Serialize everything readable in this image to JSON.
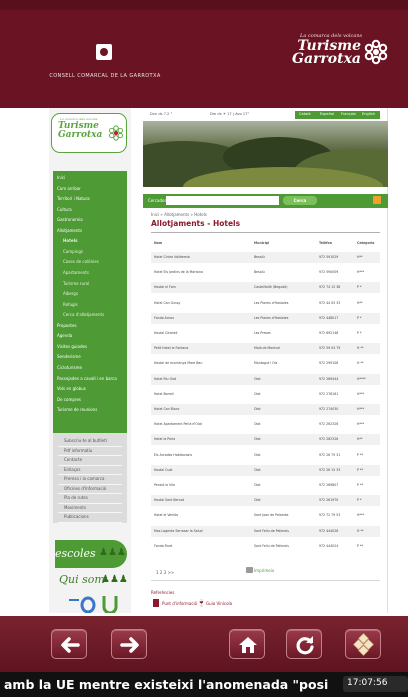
{
  "header": {
    "council_name": "CONSELL COMARCAL DE LA GARROTXA",
    "brand_tagline": "La comarca dels volcans",
    "brand_name": "Turisme Garrotxa"
  },
  "topbar": {
    "date": "Dvn ds 7.2 °",
    "weather": "Dm ds ☀ 17 | Avo 17°",
    "languages": [
      "Català",
      "Español",
      "Français",
      "English"
    ]
  },
  "sidebar": {
    "logo_tagline": "La comarca dels volcans",
    "logo_name": "Turisme Garrotxa",
    "nav": [
      {
        "label": "Inici",
        "sub": false
      },
      {
        "label": "Com arribar",
        "sub": false
      },
      {
        "label": "Territori i Natura",
        "sub": false
      },
      {
        "label": "Cultura",
        "sub": false
      },
      {
        "label": "Gastronomia",
        "sub": false
      },
      {
        "label": "Allotjaments",
        "sub": false
      },
      {
        "label": "Hotels",
        "sub": true,
        "active": true
      },
      {
        "label": "Campings",
        "sub": true
      },
      {
        "label": "Cases de colònies",
        "sub": true
      },
      {
        "label": "Apartaments",
        "sub": true
      },
      {
        "label": "Turisme rural",
        "sub": true
      },
      {
        "label": "Albergs",
        "sub": true
      },
      {
        "label": "Refugis",
        "sub": true
      },
      {
        "label": "Cerca d'allotjaments",
        "sub": true
      },
      {
        "label": "Propostes",
        "sub": false
      },
      {
        "label": "Agenda",
        "sub": false
      },
      {
        "label": "Visites guiades",
        "sub": false
      },
      {
        "label": "Senderisme",
        "sub": false
      },
      {
        "label": "Cicloturisme",
        "sub": false
      },
      {
        "label": "Passejades a cavall i en barca",
        "sub": false
      },
      {
        "label": "Vols en globus",
        "sub": false
      },
      {
        "label": "De compres",
        "sub": false
      },
      {
        "label": "Turisme de reunions",
        "sub": false
      }
    ],
    "secondary": [
      "Subscriu-te al butlletí",
      "Pdf informatiu",
      "Contacte",
      "Enllaços",
      "Premsa i la comarca",
      "Oficines d'Informació",
      "Pla de rutes",
      "Moviments",
      "Publicacions"
    ],
    "promo_escoles": "escoles",
    "promo_quisom": "Qui som"
  },
  "search": {
    "label": "Cercador",
    "placeholder": "",
    "button": "Cerca"
  },
  "content": {
    "breadcrumb": "Inici » Allotjaments » Hotels",
    "title": "Allotjaments - Hotels",
    "columns": [
      "Nom",
      "",
      "Municipi",
      "Telèfon",
      "Categoria"
    ],
    "rows": [
      {
        "name": "Hotel Cintra Valldemia",
        "icon": true,
        "town": "Besalú",
        "phone": "972 591029",
        "cat": "H**"
      },
      {
        "name": "Hotel Els Jardins de la Martana",
        "icon": false,
        "town": "Besalú",
        "phone": "972 590009",
        "cat": "H***"
      },
      {
        "name": "Hostal el Forn",
        "icon": false,
        "town": "Castellfollit (Begudà)",
        "phone": "972 74 12 38",
        "cat": "P *"
      },
      {
        "name": "Hotel Can Gussy",
        "icon": false,
        "town": "Les Planes d'Hostoles",
        "phone": "972 44 05 33",
        "cat": "H**"
      },
      {
        "name": "Fonda Arnau",
        "icon": false,
        "town": "Les Planes d'Hostoles",
        "phone": "972 448017",
        "cat": "P *"
      },
      {
        "name": "Hostal Gironell",
        "icon": false,
        "town": "Les Preses",
        "phone": "972 692148",
        "cat": "P *"
      },
      {
        "name": "Petit Hotel la Fontana",
        "icon": false,
        "town": "Maià de Montcal",
        "phone": "972 59 04 79",
        "cat": "H **"
      },
      {
        "name": "Hostal de muntanya Mare Bau",
        "icon": false,
        "town": "Montagut i Oix",
        "phone": "972 299106",
        "cat": "H **"
      },
      {
        "name": "Hotel Riu Olot",
        "icon": true,
        "town": "Olot",
        "phone": "972 269444",
        "cat": "H****"
      },
      {
        "name": "Hotel Borrell",
        "icon": true,
        "town": "Olot",
        "phone": "972 276161",
        "cat": "H***"
      },
      {
        "name": "Hotel Can Blanc",
        "icon": true,
        "town": "Olot",
        "phone": "972 274030",
        "cat": "H***"
      },
      {
        "name": "Hotel Apartament Perla d'Olot",
        "icon": true,
        "town": "Olot",
        "phone": "972 262326",
        "cat": "H***"
      },
      {
        "name": "Hotel la Perla",
        "icon": true,
        "town": "Olot",
        "phone": "972 262326",
        "cat": "H**"
      },
      {
        "name": "Els Arcades Habitacions",
        "icon": false,
        "town": "Olot",
        "phone": "972 26 75 31",
        "cat": "P **"
      },
      {
        "name": "Hostal Cuat",
        "icon": false,
        "town": "Olot",
        "phone": "972 26 15 33",
        "cat": "P **"
      },
      {
        "name": "Pensió la Vila",
        "icon": false,
        "town": "Olot",
        "phone": "972 269807",
        "cat": "P **"
      },
      {
        "name": "Hostal Sant Bernat",
        "icon": true,
        "town": "Olot",
        "phone": "972 261970",
        "cat": "P *"
      },
      {
        "name": "Hotel el Ventós",
        "icon": true,
        "town": "Sant Joan de Palamós",
        "phone": "972 72 79 53",
        "cat": "H***"
      },
      {
        "name": "Mas Lagenta Serrasar la Salud",
        "icon": true,
        "town": "Sant Feliu de Pallerols",
        "phone": "972 444026",
        "cat": "H **"
      },
      {
        "name": "Fonda Finet",
        "icon": true,
        "town": "Sant Feliu de Pallerols",
        "phone": "972 444024",
        "cat": "P **"
      }
    ],
    "pager": "1 2 3 >>",
    "print": "Imprimeix",
    "refs_label": "Referències",
    "ref1": "Punt d'informació",
    "ref2": "Guia Vinícola"
  },
  "toolbar": {
    "buttons": [
      "back-arrow",
      "forward-arrow",
      "home",
      "refresh",
      "menu-grid"
    ]
  },
  "ticker": {
    "text": "amb la UE mentre existeixi l'anomenada \"posi",
    "time": "17:07:56"
  }
}
